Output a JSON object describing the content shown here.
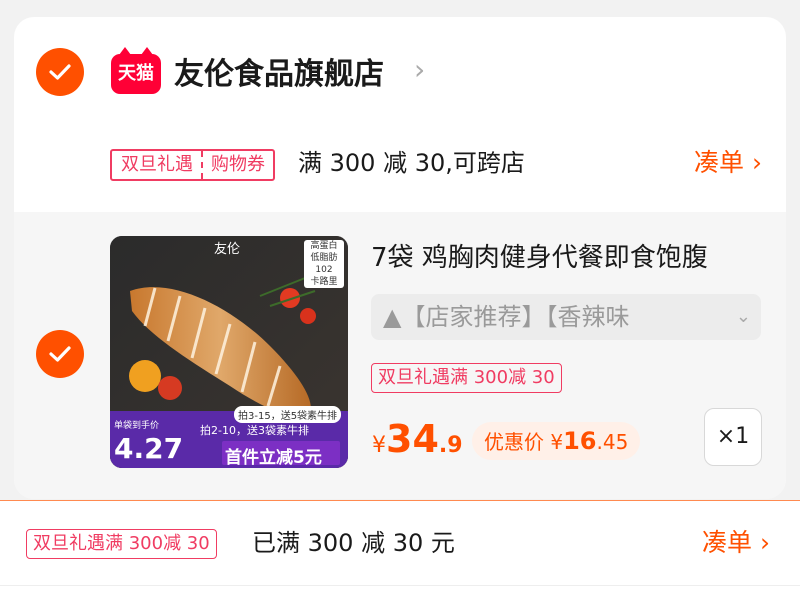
{
  "shop": {
    "logo_text": "天猫",
    "name": "友伦食品旗舰店",
    "chevron": "›"
  },
  "coupon": {
    "tag_left": "双旦礼遇",
    "tag_right": "购物券",
    "text": "满 300 减 30,可跨店",
    "link": "凑单 ›"
  },
  "item": {
    "title": "7袋 鸡胸肉健身代餐即食饱腹",
    "sku": "▲【店家推荐】【香辣味",
    "sku_chevron": "⌄",
    "promo": "双旦礼遇满 300减 30",
    "price_currency": "¥",
    "price_int": "34",
    "price_dec": ".9",
    "discount_label": "优惠价 ¥",
    "discount_int": "16",
    "discount_dec": ".45",
    "qty": "×1",
    "image": {
      "brand": "友伦",
      "badge": [
        "高蛋白",
        "低脂肪",
        "102",
        "卡路里"
      ],
      "promo1": "拍3-15，送5袋素牛排",
      "price_label": "单袋到手价",
      "price": "4.27",
      "promo2": "拍2-10，送3袋素牛排",
      "promo3": "首件立减5元"
    }
  },
  "footer": {
    "tag": "双旦礼遇满 300减 30",
    "text": "已满 300 减 30 元",
    "link": "凑单 ›"
  },
  "colors": {
    "accent": "#ff5000",
    "tag": "#f03c62",
    "tmall": "#ff0036"
  }
}
